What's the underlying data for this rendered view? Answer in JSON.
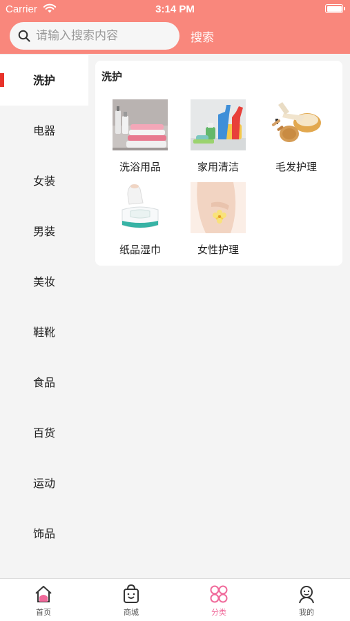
{
  "status_bar": {
    "carrier": "Carrier",
    "time": "3:14 PM"
  },
  "search": {
    "placeholder": "请输入搜索内容",
    "button_label": "搜索"
  },
  "sidebar": {
    "items": [
      {
        "label": "洗护",
        "active": true
      },
      {
        "label": "电器"
      },
      {
        "label": "女装"
      },
      {
        "label": "男装"
      },
      {
        "label": "美妆"
      },
      {
        "label": "鞋靴"
      },
      {
        "label": "食品"
      },
      {
        "label": "百货"
      },
      {
        "label": "运动"
      },
      {
        "label": "饰品"
      }
    ]
  },
  "content": {
    "section_title": "洗护",
    "subcategories": [
      {
        "label": "洗浴用品",
        "icon": "towels-toiletries-image"
      },
      {
        "label": "家用清洁",
        "icon": "cleaning-supplies-image"
      },
      {
        "label": "毛发护理",
        "icon": "hairbrush-image"
      },
      {
        "label": "纸品湿巾",
        "icon": "wet-wipes-image"
      },
      {
        "label": "女性护理",
        "icon": "flower-hand-image"
      }
    ]
  },
  "tabbar": {
    "tabs": [
      {
        "label": "首页",
        "icon": "home-icon"
      },
      {
        "label": "商城",
        "icon": "shopping-bag-icon"
      },
      {
        "label": "分类",
        "icon": "category-icon",
        "active": true
      },
      {
        "label": "我的",
        "icon": "profile-icon"
      }
    ]
  },
  "colors": {
    "header": "#f9877c",
    "active_marker": "#e8322a",
    "active_tab": "#f0699a"
  }
}
